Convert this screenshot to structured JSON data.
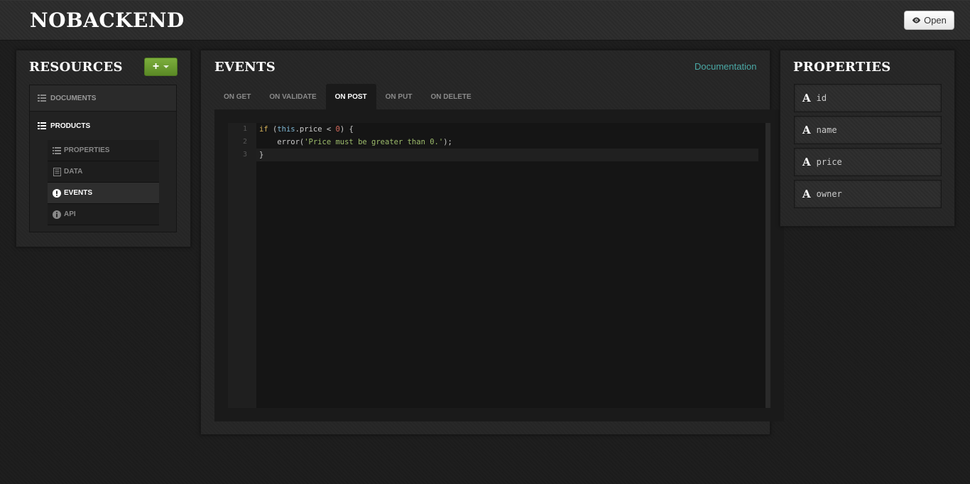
{
  "header": {
    "brand": "NOBACKEND",
    "open_label": "Open"
  },
  "resources": {
    "title": "RESOURCES",
    "add_label": "+",
    "items": [
      {
        "label": "DOCUMENTS"
      },
      {
        "label": "PRODUCTS"
      }
    ],
    "sub_items": [
      {
        "label": "PROPERTIES"
      },
      {
        "label": "DATA"
      },
      {
        "label": "EVENTS",
        "active": true
      },
      {
        "label": "API"
      }
    ]
  },
  "events": {
    "title": "EVENTS",
    "documentation_link": "Documentation",
    "tabs": [
      {
        "label": "ON GET"
      },
      {
        "label": "ON VALIDATE"
      },
      {
        "label": "ON POST",
        "active": true
      },
      {
        "label": "ON PUT"
      },
      {
        "label": "ON DELETE"
      }
    ],
    "code": {
      "line_numbers": [
        "1",
        "2",
        "3"
      ],
      "lines": [
        "if (this.price < 0) {",
        "    error('Price must be greater than 0.');",
        "}"
      ]
    }
  },
  "properties": {
    "title": "PROPERTIES",
    "type_glyph": "A",
    "items": [
      {
        "name": "id"
      },
      {
        "name": "name"
      },
      {
        "name": "price"
      },
      {
        "name": "owner"
      }
    ]
  },
  "colors": {
    "accent_green": "#6a9e31",
    "link_teal": "#4aa9a6",
    "background": "#1c1c1c"
  }
}
